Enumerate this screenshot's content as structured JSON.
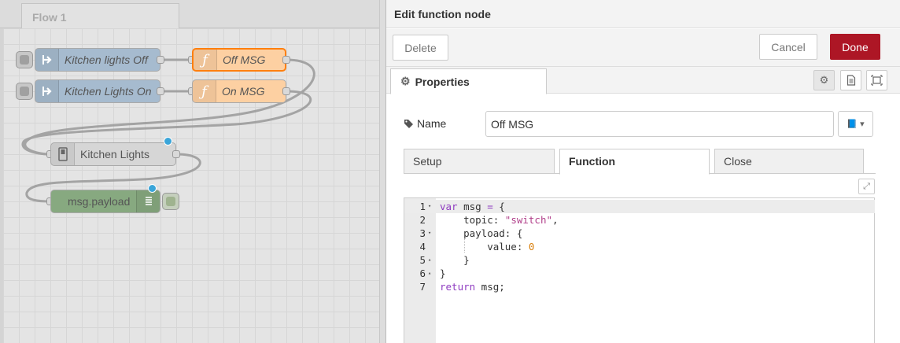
{
  "workspace": {
    "flow_tab": "Flow 1",
    "nodes": [
      {
        "label": "Kitchen lights Off"
      },
      {
        "label": "Off MSG"
      },
      {
        "label": "Kitchen Lights On"
      },
      {
        "label": "On MSG"
      },
      {
        "label": "Kitchen Lights"
      },
      {
        "label": "msg.payload"
      }
    ]
  },
  "editor": {
    "title": "Edit function node",
    "delete_label": "Delete",
    "cancel_label": "Cancel",
    "done_label": "Done",
    "properties_tab": "Properties",
    "name_label": "Name",
    "name_value": "Off MSG",
    "tabs": [
      "Setup",
      "Function",
      "Close"
    ],
    "code": {
      "line_numbers": [
        "1",
        "2",
        "3",
        "4",
        "5",
        "6",
        "7"
      ],
      "lines": [
        [
          {
            "t": "var",
            "c": "kw"
          },
          {
            "t": " msg "
          },
          {
            "t": "=",
            "c": "kw"
          },
          {
            "t": " {"
          }
        ],
        [
          {
            "t": "    topic: "
          },
          {
            "t": "\"switch\"",
            "c": "str"
          },
          {
            "t": ","
          }
        ],
        [
          {
            "t": "    payload: {"
          }
        ],
        [
          {
            "t": "        value: "
          },
          {
            "t": "0",
            "c": "num"
          }
        ],
        [
          {
            "t": "    }"
          }
        ],
        [
          {
            "t": "}"
          }
        ],
        [
          {
            "t": "return",
            "c": "kw"
          },
          {
            "t": " msg;"
          }
        ]
      ]
    }
  },
  "colors": {
    "done_button": "#ad1625",
    "inject_node": "#a6bbcf",
    "function_node": "#fdd0a2",
    "ui_switch_node": "#d6d6d6",
    "debug_node": "#87a980",
    "status_dot": "#3aa5d9"
  },
  "icons": [
    "arrow-right-icon",
    "function-icon",
    "switch-icon",
    "list-icon",
    "gear-icon",
    "tag-icon",
    "book-icon",
    "file-icon",
    "frame-icon",
    "expand-icon"
  ]
}
